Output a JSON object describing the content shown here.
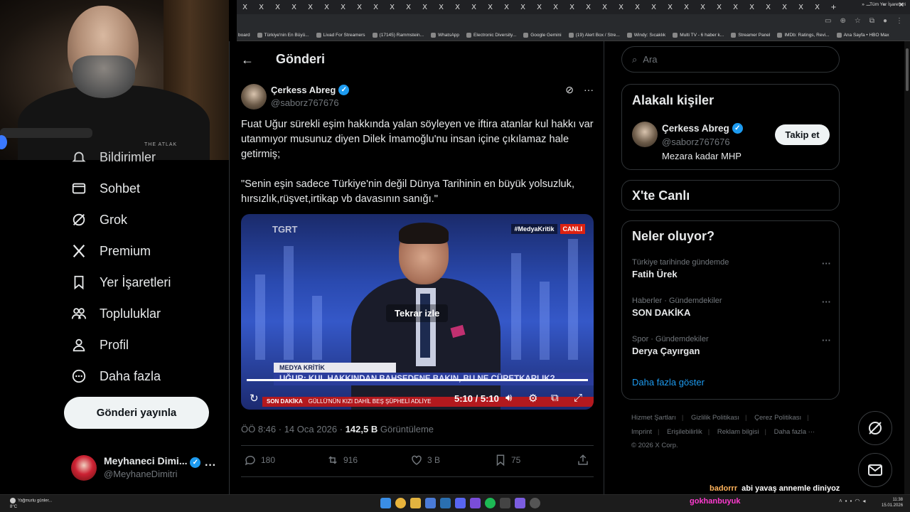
{
  "browser": {
    "tab_glyph": "X",
    "tab_count": 36,
    "new_tab": "+",
    "bookmarks": [
      "board",
      "Türkiye'nin En Büyü...",
      "Livad For Streamers",
      "(17145) Rammstein...",
      "WhatsApp",
      "Electronic Diversity...",
      "Google Gemini",
      "(19) Alert Box / Stre...",
      "Windy: Sıcaklık",
      "Multi TV - 6 haber k...",
      "Streamer Panel",
      "IMDb: Ratings, Revi...",
      "Ana Sayfa • HBO Max"
    ],
    "bookmarks_overflow": "»",
    "all_bookmarks": "Tüm Yer İşaretleri"
  },
  "webcam": {
    "shirt_logo": "THE ATLAK"
  },
  "nav": {
    "items": [
      {
        "label": "Bildirimler",
        "icon": "bell-icon"
      },
      {
        "label": "Sohbet",
        "icon": "mail-icon"
      },
      {
        "label": "Grok",
        "icon": "grok-icon"
      },
      {
        "label": "Premium",
        "icon": "x-logo-icon"
      },
      {
        "label": "Yer İşaretleri",
        "icon": "bookmark-icon"
      },
      {
        "label": "Topluluklar",
        "icon": "people-icon"
      },
      {
        "label": "Profil",
        "icon": "person-icon"
      },
      {
        "label": "Daha fazla",
        "icon": "more-circle-icon"
      }
    ],
    "post_button": "Gönderi yayınla",
    "account": {
      "name": "Meyhaneci Dimi...",
      "handle": "@MeyhaneDimitri"
    }
  },
  "main": {
    "title": "Gönderi",
    "author": {
      "name": "Çerkess Abreg",
      "handle": "@saborz767676"
    },
    "text": "Fuat Uğur sürekli eşim hakkında yalan söyleyen ve iftira atanlar kul hakkı var utanmıyor musunuz diyen Dilek İmamoğlu'nu insan içine çıkılamaz hale getirmiş;\n\n\"Senin eşin sadece Türkiye'nin değil Dünya Tarihinin en büyük yolsuzluk, hırsızlık,rüşvet,irtikap vb davasının sanığı.\"",
    "video": {
      "brand": "TGRT",
      "tag": "#MedyaKritik",
      "live": "CANLI",
      "replay": "Tekrar izle",
      "lower_third": "MEDYA KRİTİK",
      "headline": "UĞUR: KUL HAKKINDAN BAHSEDENE BAKIN, BU NE CÜRETKARLIK?",
      "ticker_label": "SON DAKİKA",
      "ticker": "GÜLLÜ'NÜN KIZI DAHİL BEŞ ŞÜPHELİ ADLİYE",
      "time": "5:10 / 5:10",
      "progress": 1.0
    },
    "meta": {
      "time": "ÖÖ 8:46 · 14 Oca 2026 · ",
      "views": "142,5 B",
      "views_label": " Görüntüleme"
    },
    "actions": {
      "replies": "180",
      "reposts": "916",
      "likes": "3 B",
      "bookmarks": "75"
    }
  },
  "right": {
    "search_placeholder": "Ara",
    "related": {
      "title": "Alakalı kişiler",
      "name": "Çerkess Abreg",
      "handle": "@saborz767676",
      "bio": "Mezara kadar MHP",
      "follow": "Takip et"
    },
    "live_title": "X'te Canlı",
    "trends_title": "Neler oluyor?",
    "trends": [
      {
        "context": "Türkiye tarihinde gündemde",
        "name": "Fatih Ürek"
      },
      {
        "context": "Haberler · Gündemdekiler",
        "name": "SON DAKİKA"
      },
      {
        "context": "Spor · Gündemdekiler",
        "name": "Derya Çayırgan"
      }
    ],
    "show_more": "Daha fazla göster",
    "footer": [
      "Hizmet Şartları",
      "Gizlilik Politikası",
      "Çerez Politikası",
      "Imprint",
      "Erişilebilirlik",
      "Reklam bilgisi",
      "Daha fazla ···",
      "© 2026 X Corp."
    ]
  },
  "chat": {
    "user": "badorrr",
    "message": "abi yavaş annemle diniyoz"
  },
  "taskbar": {
    "weather": "Yağmurlu günler...",
    "temp": "8°C",
    "streamer": "gokhanbuyuk",
    "time": "11:38",
    "date": "15.01.2026"
  }
}
